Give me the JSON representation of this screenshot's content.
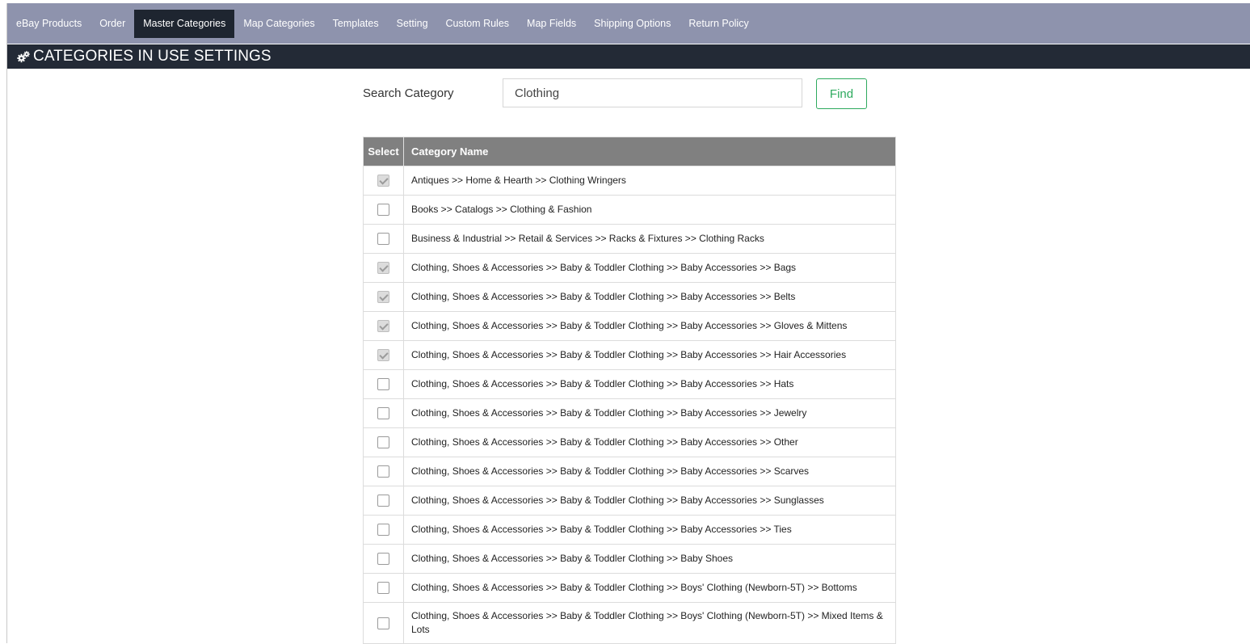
{
  "nav": {
    "items": [
      {
        "label": "eBay Products",
        "active": false
      },
      {
        "label": "Order",
        "active": false
      },
      {
        "label": "Master Categories",
        "active": true
      },
      {
        "label": "Map Categories",
        "active": false
      },
      {
        "label": "Templates",
        "active": false
      },
      {
        "label": "Setting",
        "active": false
      },
      {
        "label": "Custom Rules",
        "active": false
      },
      {
        "label": "Map Fields",
        "active": false
      },
      {
        "label": "Shipping Options",
        "active": false
      },
      {
        "label": "Return Policy",
        "active": false
      }
    ]
  },
  "header": {
    "icon": "gears-icon",
    "title": "CATEGORIES IN USE SETTINGS"
  },
  "search": {
    "label": "Search Category",
    "value": "Clothing",
    "button_label": "Find"
  },
  "table": {
    "headers": {
      "select": "Select",
      "name": "Category Name"
    },
    "rows": [
      {
        "checked": true,
        "name": "Antiques >> Home & Hearth >> Clothing Wringers"
      },
      {
        "checked": false,
        "name": "Books >> Catalogs >> Clothing & Fashion"
      },
      {
        "checked": false,
        "name": "Business & Industrial >> Retail & Services >> Racks & Fixtures >> Clothing Racks"
      },
      {
        "checked": true,
        "name": "Clothing, Shoes & Accessories >> Baby & Toddler Clothing >> Baby Accessories >> Bags"
      },
      {
        "checked": true,
        "name": "Clothing, Shoes & Accessories >> Baby & Toddler Clothing >> Baby Accessories >> Belts"
      },
      {
        "checked": true,
        "name": "Clothing, Shoes & Accessories >> Baby & Toddler Clothing >> Baby Accessories >> Gloves & Mittens"
      },
      {
        "checked": true,
        "name": "Clothing, Shoes & Accessories >> Baby & Toddler Clothing >> Baby Accessories >> Hair Accessories"
      },
      {
        "checked": false,
        "name": "Clothing, Shoes & Accessories >> Baby & Toddler Clothing >> Baby Accessories >> Hats"
      },
      {
        "checked": false,
        "name": "Clothing, Shoes & Accessories >> Baby & Toddler Clothing >> Baby Accessories >> Jewelry"
      },
      {
        "checked": false,
        "name": "Clothing, Shoes & Accessories >> Baby & Toddler Clothing >> Baby Accessories >> Other"
      },
      {
        "checked": false,
        "name": "Clothing, Shoes & Accessories >> Baby & Toddler Clothing >> Baby Accessories >> Scarves"
      },
      {
        "checked": false,
        "name": "Clothing, Shoes & Accessories >> Baby & Toddler Clothing >> Baby Accessories >> Sunglasses"
      },
      {
        "checked": false,
        "name": "Clothing, Shoes & Accessories >> Baby & Toddler Clothing >> Baby Accessories >> Ties"
      },
      {
        "checked": false,
        "name": "Clothing, Shoes & Accessories >> Baby & Toddler Clothing >> Baby Shoes"
      },
      {
        "checked": false,
        "name": "Clothing, Shoes & Accessories >> Baby & Toddler Clothing >> Boys' Clothing (Newborn-5T) >> Bottoms"
      },
      {
        "checked": false,
        "name": "Clothing, Shoes & Accessories >> Baby & Toddler Clothing >> Boys' Clothing (Newborn-5T) >> Mixed Items & Lots"
      }
    ]
  },
  "colors": {
    "nav_bg": "#8e93ad",
    "nav_active": "#1e2530",
    "header_bg": "#232a36",
    "find_green": "#2eaa5e",
    "table_header": "#808080"
  }
}
